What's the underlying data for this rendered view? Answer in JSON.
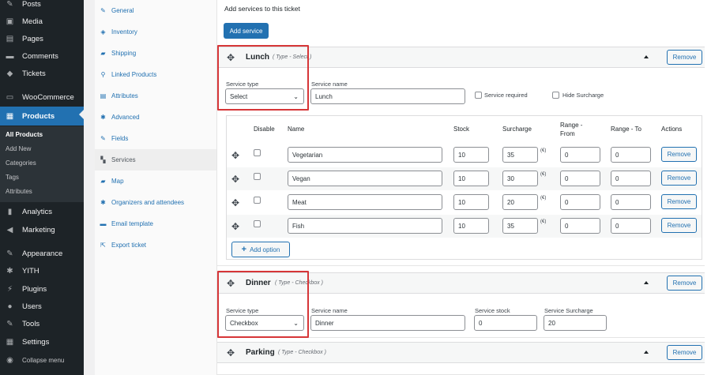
{
  "sidebar": {
    "items": [
      {
        "label": "Posts",
        "icon": "pin-icon"
      },
      {
        "label": "Media",
        "icon": "media-icon"
      },
      {
        "label": "Pages",
        "icon": "pages-icon"
      },
      {
        "label": "Comments",
        "icon": "comments-icon"
      },
      {
        "label": "Tickets",
        "icon": "tickets-icon"
      },
      {
        "label": "WooCommerce",
        "icon": "woocommerce-icon"
      },
      {
        "label": "Products",
        "icon": "products-icon"
      },
      {
        "label": "Analytics",
        "icon": "analytics-icon"
      },
      {
        "label": "Marketing",
        "icon": "marketing-icon"
      },
      {
        "label": "Appearance",
        "icon": "appearance-icon"
      },
      {
        "label": "YITH",
        "icon": "yith-icon"
      },
      {
        "label": "Plugins",
        "icon": "plugins-icon"
      },
      {
        "label": "Users",
        "icon": "users-icon"
      },
      {
        "label": "Tools",
        "icon": "tools-icon"
      },
      {
        "label": "Settings",
        "icon": "settings-icon"
      },
      {
        "label": "Collapse menu",
        "icon": "collapse-icon"
      }
    ],
    "submenu": [
      "All Products",
      "Add New",
      "Categories",
      "Tags",
      "Attributes"
    ]
  },
  "tabs": [
    {
      "label": "General",
      "icon": "wrench-icon"
    },
    {
      "label": "Inventory",
      "icon": "inventory-icon"
    },
    {
      "label": "Shipping",
      "icon": "truck-icon"
    },
    {
      "label": "Linked Products",
      "icon": "link-icon"
    },
    {
      "label": "Attributes",
      "icon": "list-icon"
    },
    {
      "label": "Advanced",
      "icon": "gear-icon"
    },
    {
      "label": "Fields",
      "icon": "pencil-icon"
    },
    {
      "label": "Services",
      "icon": "services-icon"
    },
    {
      "label": "Map",
      "icon": "map-icon"
    },
    {
      "label": "Organizers and attendees",
      "icon": "organizers-icon"
    },
    {
      "label": "Email template",
      "icon": "email-icon"
    },
    {
      "label": "Export ticket",
      "icon": "export-icon"
    }
  ],
  "main": {
    "add_label": "Add services to this ticket",
    "add_service_button": "Add service",
    "remove_label": "Remove",
    "service_type_label": "Service type",
    "service_name_label": "Service name",
    "service_required_label": "Service required",
    "hide_surcharge_label": "Hide Surcharge",
    "service_stock_label": "Service stock",
    "service_surcharge_label": "Service Surcharge",
    "add_option_label": "Add option",
    "currency": "(€)",
    "services": [
      {
        "title": "Lunch",
        "type_label": "( Type - Select )",
        "type_value": "Select",
        "name_value": "Lunch"
      },
      {
        "title": "Dinner",
        "type_label": "( Type - Checkbox )",
        "type_value": "Checkbox",
        "name_value": "Dinner",
        "stock_value": "0",
        "surcharge_value": "20"
      },
      {
        "title": "Parking",
        "type_label": "( Type - Checkbox )"
      }
    ],
    "table": {
      "headers": {
        "disable": "Disable",
        "name": "Name",
        "stock": "Stock",
        "surcharge": "Surcharge",
        "range_from": "Range -\nFrom",
        "range_to": "Range - To",
        "actions": "Actions"
      },
      "rows": [
        {
          "name": "Vegetarian",
          "stock": "10",
          "surcharge": "35",
          "from": "0",
          "to": "0"
        },
        {
          "name": "Vegan",
          "stock": "10",
          "surcharge": "30",
          "from": "0",
          "to": "0"
        },
        {
          "name": "Meat",
          "stock": "10",
          "surcharge": "20",
          "from": "0",
          "to": "0"
        },
        {
          "name": "Fish",
          "stock": "10",
          "surcharge": "35",
          "from": "0",
          "to": "0"
        }
      ]
    }
  },
  "colors": {
    "accent": "#2271b1",
    "sidebar_bg": "#1d2327",
    "highlight_frame": "#d63638"
  }
}
